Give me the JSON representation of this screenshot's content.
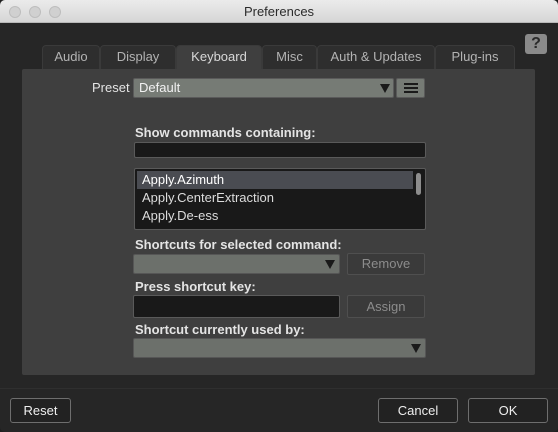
{
  "window": {
    "title": "Preferences"
  },
  "help": {
    "glyph": "?"
  },
  "tabs": [
    {
      "label": "Audio",
      "active": false
    },
    {
      "label": "Display",
      "active": false
    },
    {
      "label": "Keyboard",
      "active": true
    },
    {
      "label": "Misc",
      "active": false
    },
    {
      "label": "Auth & Updates",
      "active": false
    },
    {
      "label": "Plug-ins",
      "active": false
    }
  ],
  "preset": {
    "label": "Preset",
    "value": "Default"
  },
  "filter": {
    "label": "Show commands containing:",
    "value": ""
  },
  "commands": [
    {
      "label": "Apply.Azimuth",
      "selected": true
    },
    {
      "label": "Apply.CenterExtraction",
      "selected": false
    },
    {
      "label": "Apply.De-ess",
      "selected": false
    }
  ],
  "shortcuts": {
    "label": "Shortcuts for selected command:",
    "remove_label": "Remove"
  },
  "press_key": {
    "label": "Press shortcut key:",
    "value": "",
    "assign_label": "Assign"
  },
  "used_by": {
    "label": "Shortcut currently used by:"
  },
  "footer": {
    "reset_label": "Reset",
    "cancel_label": "Cancel",
    "ok_label": "OK"
  }
}
